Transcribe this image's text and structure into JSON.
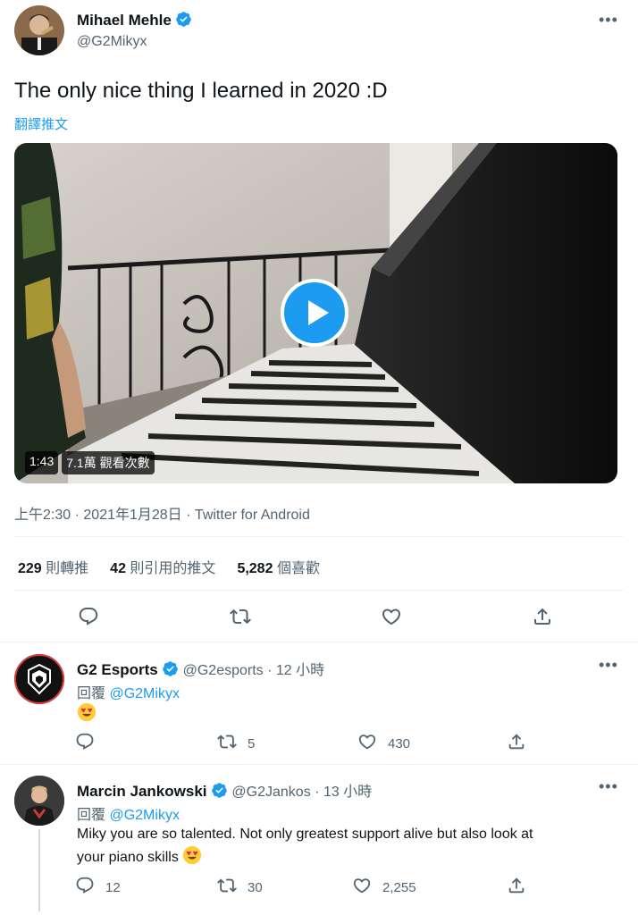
{
  "tweet": {
    "author_name": "Mihael Mehle",
    "author_handle": "@G2Mikyx",
    "text": "The only nice thing I learned in 2020 :D",
    "translate_label": "翻譯推文",
    "video": {
      "duration": "1:43",
      "views": "7.1萬 觀看次數"
    },
    "meta": {
      "time": "上午2:30",
      "date": "2021年1月28日",
      "source": "Twitter for Android",
      "sep": "·"
    },
    "stats": [
      {
        "num": "229",
        "label": "則轉推"
      },
      {
        "num": "42",
        "label": "則引用的推文"
      },
      {
        "num": "5,282",
        "label": "個喜歡"
      }
    ]
  },
  "replies": [
    {
      "name": "G2 Esports",
      "handle": "@G2esports",
      "time": "12 小時",
      "reply_prefix": "回覆",
      "reply_to": "@G2Mikyx",
      "text": "",
      "counts": {
        "reply": "",
        "retweet": "5",
        "like": "430"
      }
    },
    {
      "name": "Marcin Jankowski",
      "handle": "@G2Jankos",
      "time": "13 小時",
      "reply_prefix": "回覆",
      "reply_to": "@G2Mikyx",
      "text_line1": "Miky you are so talented. Not only greatest support alive but also look at",
      "text_line2": "your piano skills",
      "counts": {
        "reply": "12",
        "retweet": "30",
        "like": "2,255"
      }
    }
  ],
  "colors": {
    "accent": "#1d9bf0",
    "muted": "#536471"
  }
}
